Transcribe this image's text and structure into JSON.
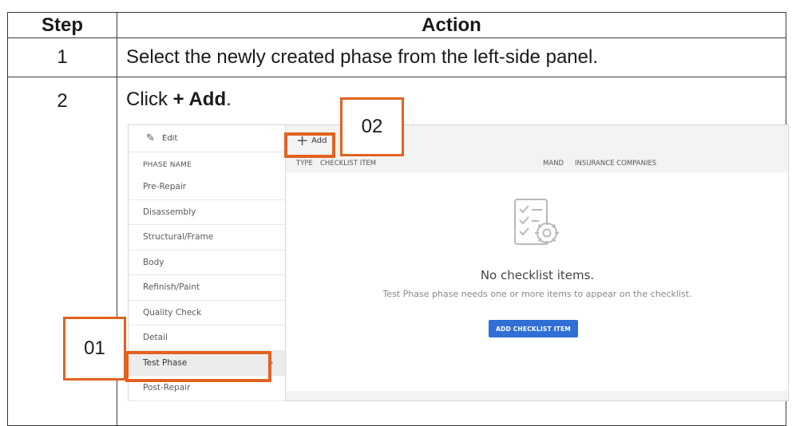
{
  "table": {
    "header_step": "Step",
    "header_action": "Action",
    "rows": [
      {
        "step": "1",
        "action": "Select the newly created phase from the left-side panel."
      },
      {
        "step": "2",
        "action_prefix": "Click ",
        "action_bold": "+ Add",
        "action_suffix": "."
      }
    ]
  },
  "screenshot": {
    "edit_label": "Edit",
    "phase_column_header": "PHASE NAME",
    "phases": [
      "Pre-Repair",
      "Disassembly",
      "Structural/Frame",
      "Body",
      "Refinish/Paint",
      "Quality Check",
      "Detail",
      "Test Phase",
      "Post-Repair"
    ],
    "selected_phase": "Test Phase",
    "add_button": "Add",
    "columns": {
      "type": "TYPE",
      "checklist_item": "CHECKLIST ITEM",
      "mand": "MAND",
      "insurance": "INSURANCE COMPANIES"
    },
    "empty_title": "No checklist items.",
    "empty_subtitle": "Test Phase phase needs one or more items to appear on the checklist.",
    "add_checklist_button": "ADD CHECKLIST ITEM"
  },
  "callouts": {
    "first": "01",
    "second": "02"
  },
  "colors": {
    "callout": "#e2621f",
    "primary_button": "#2f6fd6"
  }
}
